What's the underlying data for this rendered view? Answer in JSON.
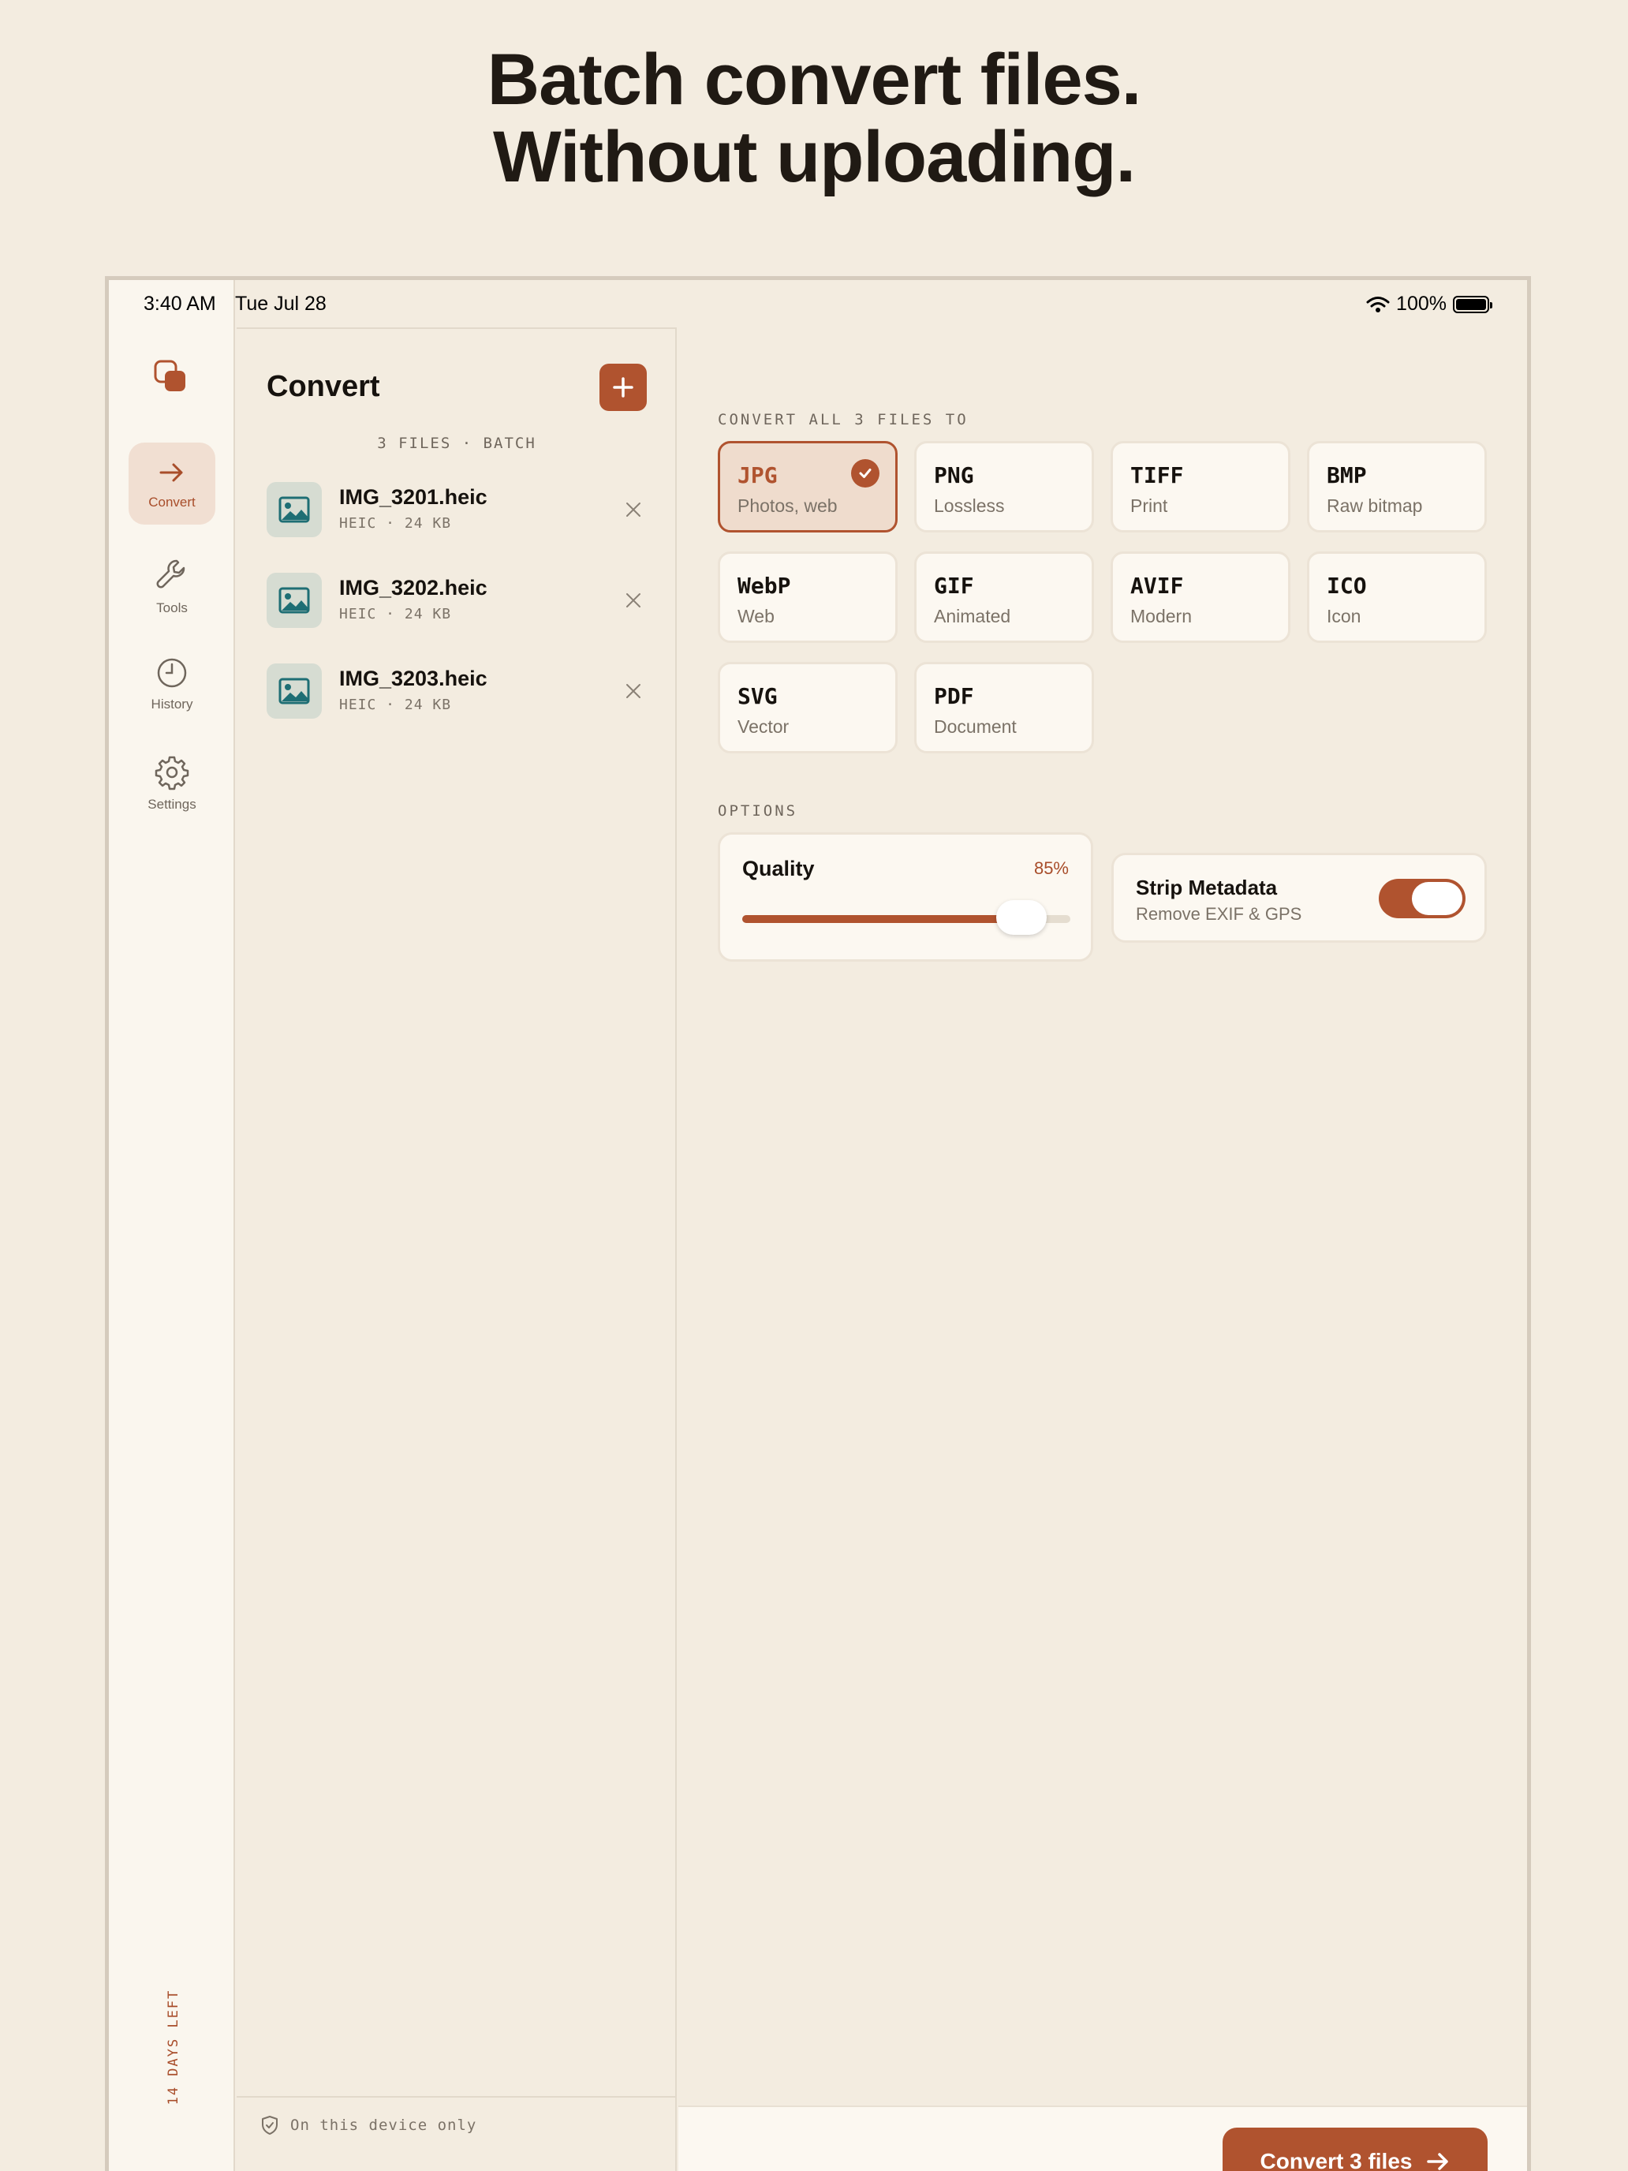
{
  "headline": {
    "line1": "Batch convert files.",
    "line2": "Without uploading."
  },
  "status_bar": {
    "time": "3:40 AM",
    "date": "Tue Jul 28",
    "battery": "100%"
  },
  "nav_rail": {
    "items": [
      {
        "label": "Convert",
        "icon": "arrow-right-icon",
        "active": true
      },
      {
        "label": "Tools",
        "icon": "wrench-icon",
        "active": false
      },
      {
        "label": "History",
        "icon": "clock-icon",
        "active": false
      },
      {
        "label": "Settings",
        "icon": "gear-icon",
        "active": false
      }
    ],
    "trial": "14 DAYS LEFT"
  },
  "files_panel": {
    "title": "Convert",
    "meta": "3 FILES · BATCH",
    "files": [
      {
        "name": "IMG_3201.heic",
        "info": "HEIC · 24 KB"
      },
      {
        "name": "IMG_3202.heic",
        "info": "HEIC · 24 KB"
      },
      {
        "name": "IMG_3203.heic",
        "info": "HEIC · 24 KB"
      }
    ],
    "footer": "On this device only"
  },
  "formats": {
    "label": "CONVERT ALL 3 FILES TO",
    "items": [
      {
        "name": "JPG",
        "desc": "Photos, web",
        "selected": true
      },
      {
        "name": "PNG",
        "desc": "Lossless",
        "selected": false
      },
      {
        "name": "TIFF",
        "desc": "Print",
        "selected": false
      },
      {
        "name": "BMP",
        "desc": "Raw bitmap",
        "selected": false
      },
      {
        "name": "WebP",
        "desc": "Web",
        "selected": false
      },
      {
        "name": "GIF",
        "desc": "Animated",
        "selected": false
      },
      {
        "name": "AVIF",
        "desc": "Modern",
        "selected": false
      },
      {
        "name": "ICO",
        "desc": "Icon",
        "selected": false
      },
      {
        "name": "SVG",
        "desc": "Vector",
        "selected": false
      },
      {
        "name": "PDF",
        "desc": "Document",
        "selected": false
      }
    ]
  },
  "options": {
    "label": "OPTIONS",
    "quality": {
      "title": "Quality",
      "value_text": "85%",
      "value": 0.85
    },
    "strip_metadata": {
      "title": "Strip Metadata",
      "subtitle": "Remove EXIF & GPS",
      "enabled": true
    }
  },
  "action": {
    "convert_label": "Convert 3 files"
  },
  "colors": {
    "accent": "#b0532f",
    "background": "#f3ece0",
    "card": "#fcf8f1"
  }
}
